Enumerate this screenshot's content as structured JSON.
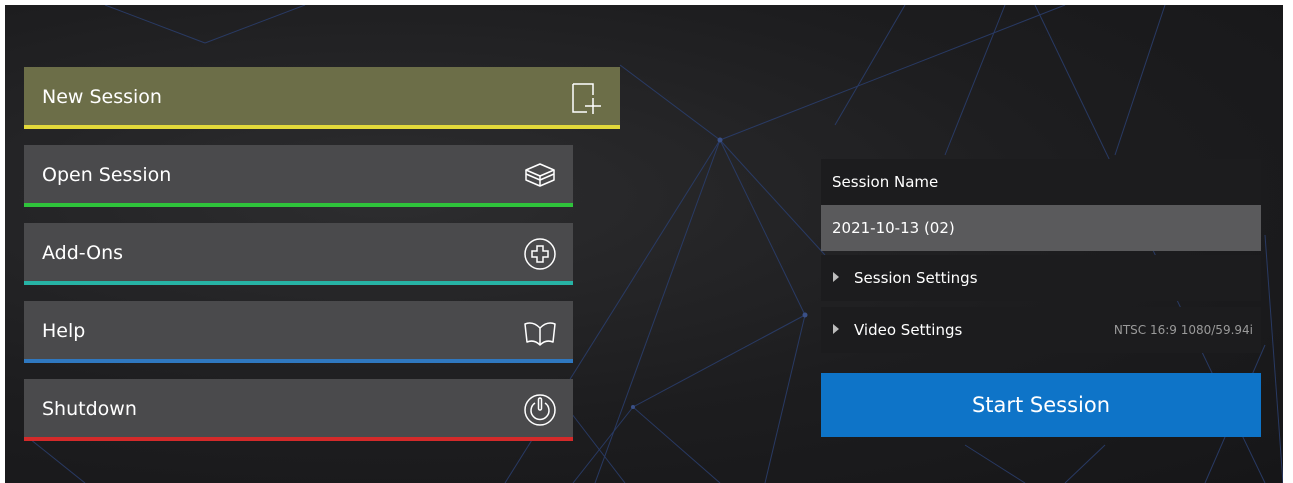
{
  "menu": {
    "items": [
      {
        "label": "New Session",
        "accent": "#e3d93a",
        "icon": "new-session-icon"
      },
      {
        "label": "Open Session",
        "accent": "#2fc33b",
        "icon": "open-box-icon"
      },
      {
        "label": "Add-Ons",
        "accent": "#27b3a5",
        "icon": "plus-circle-icon"
      },
      {
        "label": "Help",
        "accent": "#2f78c0",
        "icon": "book-icon"
      },
      {
        "label": "Shutdown",
        "accent": "#d42a2a",
        "icon": "power-icon"
      }
    ]
  },
  "session": {
    "name_label": "Session Name",
    "name_value": "2021-10-13 (02)",
    "settings_label": "Session Settings",
    "video_label": "Video Settings",
    "video_value": "NTSC 16:9 1080/59.94i",
    "start_label": "Start Session"
  },
  "colors": {
    "active_item_bg": "#6c6e48",
    "item_bg": "#4a4a4c",
    "start_button": "#0e74c8"
  }
}
